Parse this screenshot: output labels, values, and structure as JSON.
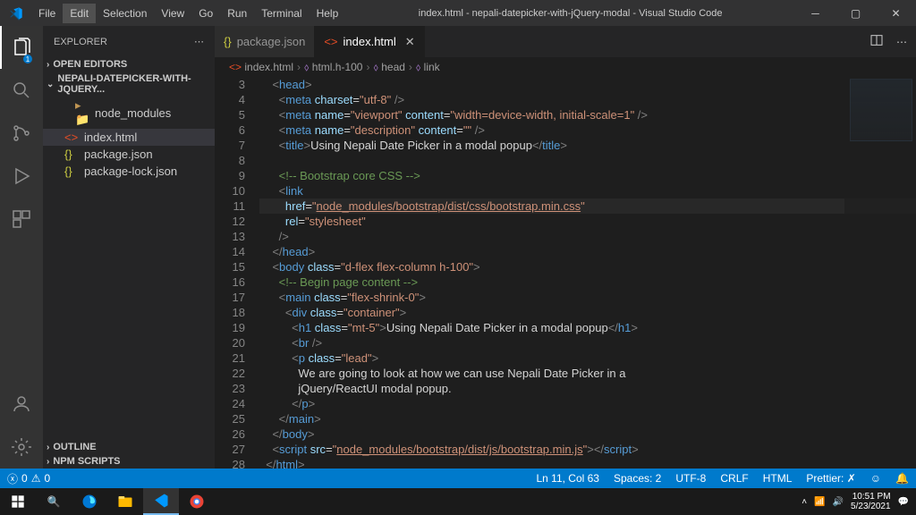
{
  "menu": [
    "File",
    "Edit",
    "Selection",
    "View",
    "Go",
    "Run",
    "Terminal",
    "Help"
  ],
  "menu_active": 1,
  "title": "index.html - nepali-datepicker-with-jQuery-modal - Visual Studio Code",
  "sidebar_title": "EXPLORER",
  "sections": {
    "open_editors": "OPEN EDITORS",
    "project": "NEPALI-DATEPICKER-WITH-JQUERY...",
    "outline": "OUTLINE",
    "npm": "NPM SCRIPTS"
  },
  "files": [
    {
      "name": "node_modules",
      "icon": "folder",
      "indent": 1
    },
    {
      "name": "index.html",
      "icon": "html",
      "indent": 0,
      "active": true
    },
    {
      "name": "package.json",
      "icon": "json",
      "indent": 0
    },
    {
      "name": "package-lock.json",
      "icon": "json",
      "indent": 0
    }
  ],
  "tabs": [
    {
      "label": "package.json",
      "icon": "json",
      "active": false
    },
    {
      "label": "index.html",
      "icon": "html",
      "active": true
    }
  ],
  "breadcrumb": [
    {
      "icon": "html",
      "label": "index.html"
    },
    {
      "icon": "tag",
      "label": "html.h-100"
    },
    {
      "icon": "tag",
      "label": "head"
    },
    {
      "icon": "tag",
      "label": "link"
    }
  ],
  "code_lines": [
    {
      "n": 3,
      "seg": [
        [
          "    ",
          "txt"
        ],
        [
          "<",
          "br"
        ],
        [
          "head",
          "tag"
        ],
        [
          ">",
          "br"
        ]
      ]
    },
    {
      "n": 4,
      "seg": [
        [
          "      ",
          "txt"
        ],
        [
          "<",
          "br"
        ],
        [
          "meta",
          "tag"
        ],
        [
          " charset",
          "attr"
        ],
        [
          "=",
          "txt"
        ],
        [
          "\"utf-8\"",
          "str"
        ],
        [
          " />",
          "br"
        ]
      ]
    },
    {
      "n": 5,
      "seg": [
        [
          "      ",
          "txt"
        ],
        [
          "<",
          "br"
        ],
        [
          "meta",
          "tag"
        ],
        [
          " name",
          "attr"
        ],
        [
          "=",
          "txt"
        ],
        [
          "\"viewport\"",
          "str"
        ],
        [
          " content",
          "attr"
        ],
        [
          "=",
          "txt"
        ],
        [
          "\"width=device-width, initial-scale=1\"",
          "str"
        ],
        [
          " />",
          "br"
        ]
      ]
    },
    {
      "n": 6,
      "seg": [
        [
          "      ",
          "txt"
        ],
        [
          "<",
          "br"
        ],
        [
          "meta",
          "tag"
        ],
        [
          " name",
          "attr"
        ],
        [
          "=",
          "txt"
        ],
        [
          "\"description\"",
          "str"
        ],
        [
          " content",
          "attr"
        ],
        [
          "=",
          "txt"
        ],
        [
          "\"\"",
          "str"
        ],
        [
          " />",
          "br"
        ]
      ]
    },
    {
      "n": 7,
      "seg": [
        [
          "      ",
          "txt"
        ],
        [
          "<",
          "br"
        ],
        [
          "title",
          "tag"
        ],
        [
          ">",
          "br"
        ],
        [
          "Using Nepali Date Picker in a modal popup",
          "txt"
        ],
        [
          "</",
          "br"
        ],
        [
          "title",
          "tag"
        ],
        [
          ">",
          "br"
        ]
      ]
    },
    {
      "n": 8,
      "seg": [
        [
          "",
          "txt"
        ]
      ]
    },
    {
      "n": 9,
      "seg": [
        [
          "      ",
          "txt"
        ],
        [
          "<!-- Bootstrap core CSS -->",
          "cmt"
        ]
      ]
    },
    {
      "n": 10,
      "seg": [
        [
          "      ",
          "txt"
        ],
        [
          "<",
          "br"
        ],
        [
          "link",
          "tag"
        ]
      ]
    },
    {
      "n": 11,
      "hl": true,
      "seg": [
        [
          "        ",
          "txt"
        ],
        [
          "href",
          "attr"
        ],
        [
          "=",
          "txt"
        ],
        [
          "\"",
          "str"
        ],
        [
          "node_modules/bootstrap/dist/css/bootstrap.min.css",
          "str und"
        ],
        [
          "\"",
          "str"
        ]
      ]
    },
    {
      "n": 12,
      "seg": [
        [
          "        ",
          "txt"
        ],
        [
          "rel",
          "attr"
        ],
        [
          "=",
          "txt"
        ],
        [
          "\"stylesheet\"",
          "str"
        ]
      ]
    },
    {
      "n": 13,
      "seg": [
        [
          "      ",
          "txt"
        ],
        [
          "/>",
          "br"
        ]
      ]
    },
    {
      "n": 14,
      "seg": [
        [
          "    ",
          "txt"
        ],
        [
          "</",
          "br"
        ],
        [
          "head",
          "tag"
        ],
        [
          ">",
          "br"
        ]
      ]
    },
    {
      "n": 15,
      "seg": [
        [
          "    ",
          "txt"
        ],
        [
          "<",
          "br"
        ],
        [
          "body",
          "tag"
        ],
        [
          " class",
          "attr"
        ],
        [
          "=",
          "txt"
        ],
        [
          "\"d-flex flex-column h-100\"",
          "str"
        ],
        [
          ">",
          "br"
        ]
      ]
    },
    {
      "n": 16,
      "seg": [
        [
          "      ",
          "txt"
        ],
        [
          "<!-- Begin page content -->",
          "cmt"
        ]
      ]
    },
    {
      "n": 17,
      "seg": [
        [
          "      ",
          "txt"
        ],
        [
          "<",
          "br"
        ],
        [
          "main",
          "tag"
        ],
        [
          " class",
          "attr"
        ],
        [
          "=",
          "txt"
        ],
        [
          "\"flex-shrink-0\"",
          "str"
        ],
        [
          ">",
          "br"
        ]
      ]
    },
    {
      "n": 18,
      "seg": [
        [
          "        ",
          "txt"
        ],
        [
          "<",
          "br"
        ],
        [
          "div",
          "tag"
        ],
        [
          " class",
          "attr"
        ],
        [
          "=",
          "txt"
        ],
        [
          "\"container\"",
          "str"
        ],
        [
          ">",
          "br"
        ]
      ]
    },
    {
      "n": 19,
      "seg": [
        [
          "          ",
          "txt"
        ],
        [
          "<",
          "br"
        ],
        [
          "h1",
          "tag"
        ],
        [
          " class",
          "attr"
        ],
        [
          "=",
          "txt"
        ],
        [
          "\"mt-5\"",
          "str"
        ],
        [
          ">",
          "br"
        ],
        [
          "Using Nepali Date Picker in a modal popup",
          "txt"
        ],
        [
          "</",
          "br"
        ],
        [
          "h1",
          "tag"
        ],
        [
          ">",
          "br"
        ]
      ]
    },
    {
      "n": 20,
      "seg": [
        [
          "          ",
          "txt"
        ],
        [
          "<",
          "br"
        ],
        [
          "br",
          "tag"
        ],
        [
          " />",
          "br"
        ]
      ]
    },
    {
      "n": 21,
      "seg": [
        [
          "          ",
          "txt"
        ],
        [
          "<",
          "br"
        ],
        [
          "p",
          "tag"
        ],
        [
          " class",
          "attr"
        ],
        [
          "=",
          "txt"
        ],
        [
          "\"lead\"",
          "str"
        ],
        [
          ">",
          "br"
        ]
      ]
    },
    {
      "n": 22,
      "seg": [
        [
          "            We are going to look at how we can use Nepali Date Picker in a",
          "txt"
        ]
      ]
    },
    {
      "n": 23,
      "seg": [
        [
          "            jQuery/ReactUI modal popup.",
          "txt"
        ]
      ]
    },
    {
      "n": 24,
      "seg": [
        [
          "          ",
          "txt"
        ],
        [
          "</",
          "br"
        ],
        [
          "p",
          "tag"
        ],
        [
          ">",
          "br"
        ]
      ]
    },
    {
      "n": 25,
      "seg": [
        [
          "      ",
          "txt"
        ],
        [
          "</",
          "br"
        ],
        [
          "main",
          "tag"
        ],
        [
          ">",
          "br"
        ]
      ]
    },
    {
      "n": 26,
      "seg": [
        [
          "    ",
          "txt"
        ],
        [
          "</",
          "br"
        ],
        [
          "body",
          "tag"
        ],
        [
          ">",
          "br"
        ]
      ]
    },
    {
      "n": 27,
      "seg": [
        [
          "    ",
          "txt"
        ],
        [
          "<",
          "br"
        ],
        [
          "script",
          "tag"
        ],
        [
          " src",
          "attr"
        ],
        [
          "=",
          "txt"
        ],
        [
          "\"",
          "str"
        ],
        [
          "node_modules/bootstrap/dist/js/bootstrap.min.js",
          "str und"
        ],
        [
          "\"",
          "str"
        ],
        [
          ">",
          "br"
        ],
        [
          "</",
          "br"
        ],
        [
          "script",
          "tag"
        ],
        [
          ">",
          "br"
        ]
      ]
    },
    {
      "n": 28,
      "seg": [
        [
          "  ",
          "txt"
        ],
        [
          "</",
          "br"
        ],
        [
          "html",
          "tag"
        ],
        [
          ">",
          "br"
        ]
      ]
    }
  ],
  "status": {
    "errors": "0",
    "warnings": "0",
    "ln_col": "Ln 11, Col 63",
    "spaces": "Spaces: 2",
    "encoding": "UTF-8",
    "eol": "CRLF",
    "lang": "HTML",
    "prettier": "Prettier: ✗"
  },
  "tray": {
    "time": "10:51 PM",
    "date": "5/23/2021"
  }
}
